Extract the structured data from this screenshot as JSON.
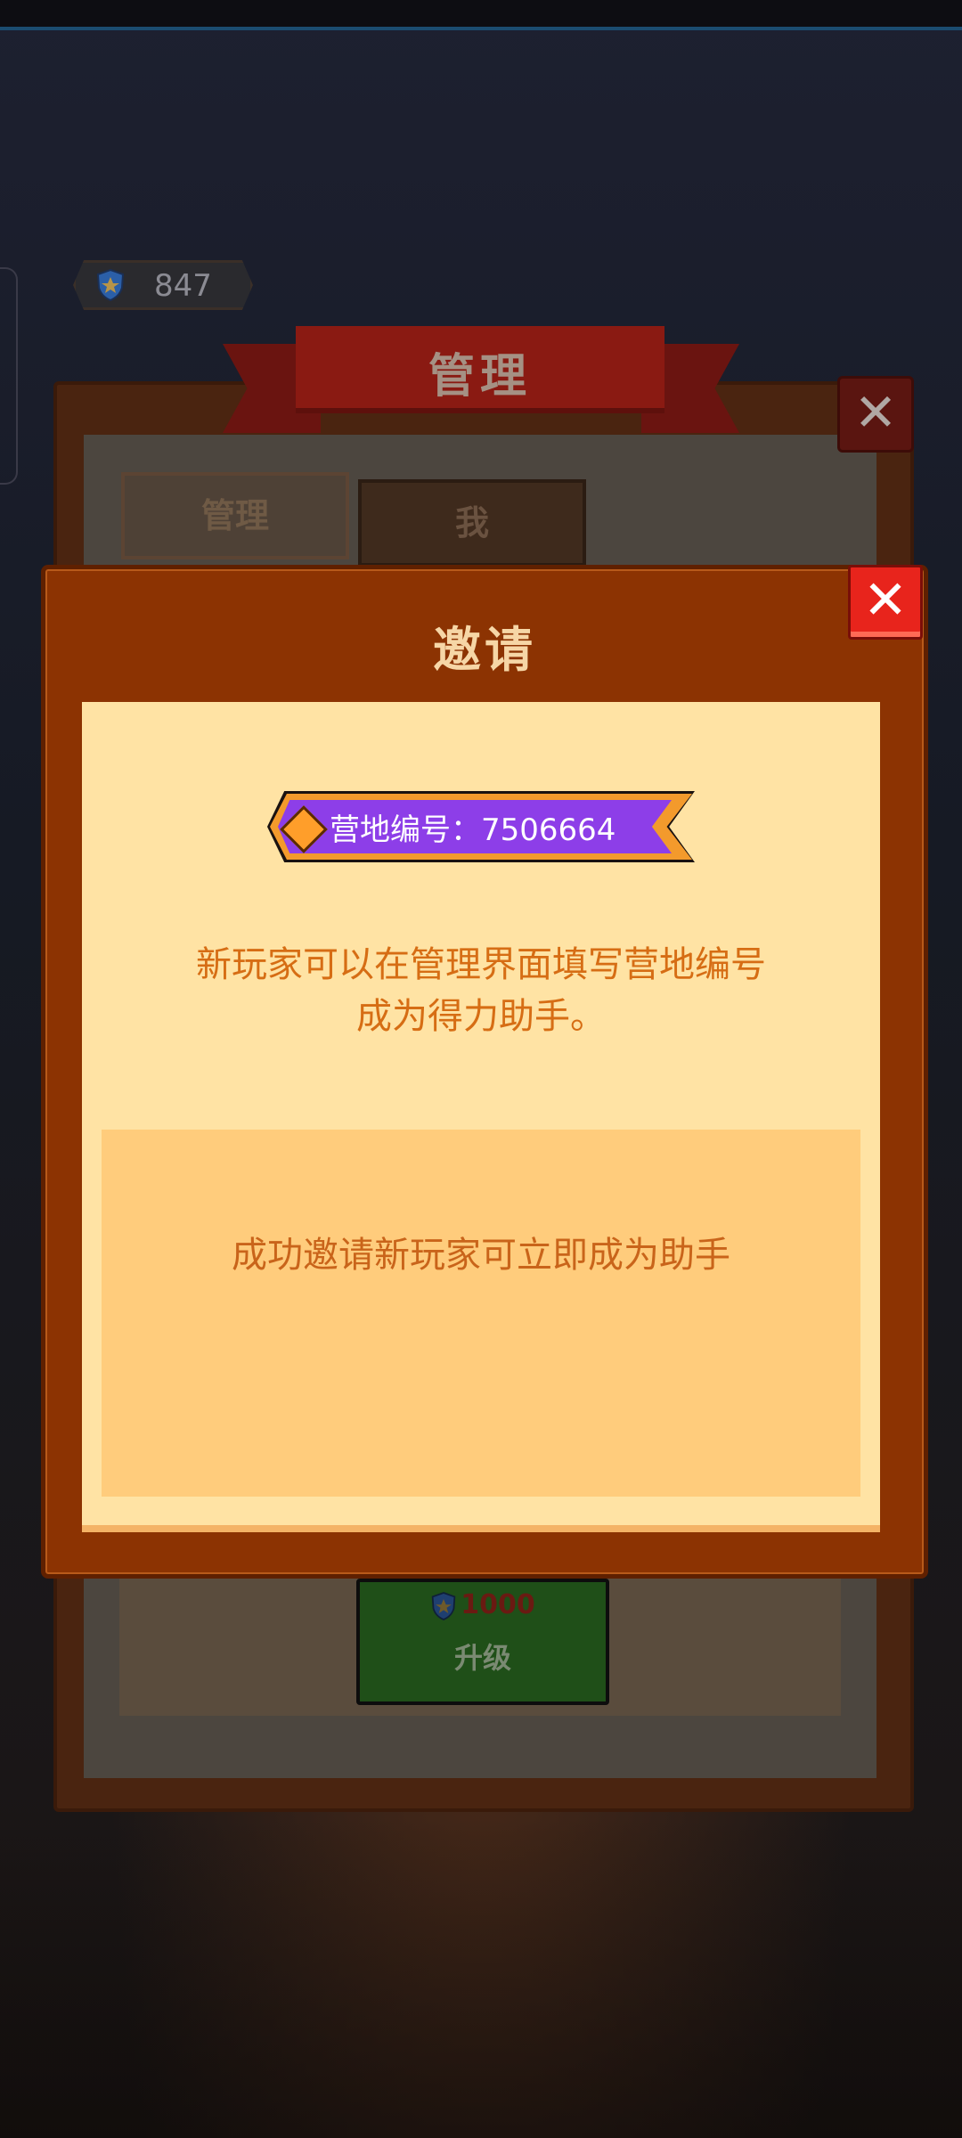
{
  "currency": {
    "value": "847"
  },
  "manage_panel": {
    "title": "管理",
    "tabs": [
      {
        "label": "管理"
      },
      {
        "label": "我"
      }
    ],
    "upgrade": {
      "cost": "1000",
      "label": "升级"
    }
  },
  "invite_dialog": {
    "title": "邀请",
    "camp_id_label": "营地编号：7506664",
    "description_line1": "新玩家可以在管理界面填写营地编号",
    "description_line2": "成为得力助手。",
    "reward_text": "成功邀请新玩家可立即成为助手",
    "close_glyph": "✕"
  },
  "colors": {
    "dialog_bg": "#8c3302",
    "body_bg": "#ffe3a4",
    "badge": "#8d3ee8",
    "close_red": "#e8241c",
    "text_orange": "#d66d14"
  },
  "icons": [
    "shield-icon",
    "gem-icon",
    "close-icon"
  ]
}
